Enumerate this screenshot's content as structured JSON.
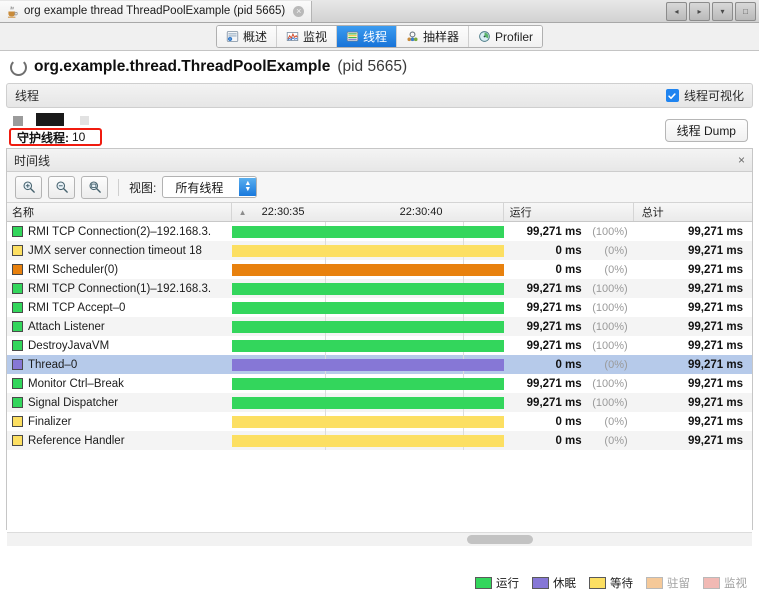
{
  "window": {
    "document_tab_title": "org example thread ThreadPoolExample (pid 5665)",
    "document_tab_close": "×",
    "nav_back": "◂",
    "nav_forward": "▸",
    "nav_dropdown": "▾",
    "maximize": "□"
  },
  "tabs": [
    {
      "label": "概述",
      "icon": "overview-icon",
      "selected": false
    },
    {
      "label": "监视",
      "icon": "monitor-icon",
      "selected": false
    },
    {
      "label": "线程",
      "icon": "threads-icon",
      "selected": true
    },
    {
      "label": "抽样器",
      "icon": "sampler-icon",
      "selected": false
    },
    {
      "label": "Profiler",
      "icon": "profiler-icon",
      "selected": false
    }
  ],
  "app_header": {
    "title": "org.example.thread.ThreadPoolExample",
    "pid": "(pid 5665)"
  },
  "section": {
    "title": "线程",
    "checkbox_label": "线程可视化",
    "checkbox_checked": true
  },
  "stats": {
    "daemon_label": "守护线程:",
    "daemon_value": "10",
    "highlight_color": "#f01b0f",
    "dump_button": "线程 Dump"
  },
  "timeline": {
    "panel_title": "时间线",
    "close": "×",
    "zoom_in": "zoom-in-icon",
    "zoom_out": "zoom-out-icon",
    "zoom_fit": "zoom-fit-icon",
    "view_label": "视图:",
    "view_value": "所有线程"
  },
  "grid": {
    "columns": {
      "name": "名称",
      "running": "运行",
      "total": "总计"
    },
    "time_ticks": [
      "22:30:35",
      "22:30:40"
    ],
    "rows": [
      {
        "name": "RMI TCP Connection(2)–192.168.3.",
        "color": "#33d65c",
        "running": "99,271 ms",
        "percent": "(100%)",
        "total": "99,271 ms",
        "selected": false
      },
      {
        "name": "JMX server connection timeout 18",
        "color": "#fcdf62",
        "running": "0 ms",
        "percent": "(0%)",
        "total": "99,271 ms",
        "selected": false
      },
      {
        "name": "RMI Scheduler(0)",
        "color": "#e8810e",
        "running": "0 ms",
        "percent": "(0%)",
        "total": "99,271 ms",
        "selected": false
      },
      {
        "name": "RMI TCP Connection(1)–192.168.3.",
        "color": "#33d65c",
        "running": "99,271 ms",
        "percent": "(100%)",
        "total": "99,271 ms",
        "selected": false
      },
      {
        "name": "RMI TCP Accept–0",
        "color": "#33d65c",
        "running": "99,271 ms",
        "percent": "(100%)",
        "total": "99,271 ms",
        "selected": false
      },
      {
        "name": "Attach Listener",
        "color": "#33d65c",
        "running": "99,271 ms",
        "percent": "(100%)",
        "total": "99,271 ms",
        "selected": false
      },
      {
        "name": "DestroyJavaVM",
        "color": "#33d65c",
        "running": "99,271 ms",
        "percent": "(100%)",
        "total": "99,271 ms",
        "selected": false
      },
      {
        "name": "Thread–0",
        "color": "#8677d6",
        "running": "0 ms",
        "percent": "(0%)",
        "total": "99,271 ms",
        "selected": true
      },
      {
        "name": "Monitor Ctrl–Break",
        "color": "#33d65c",
        "running": "99,271 ms",
        "percent": "(100%)",
        "total": "99,271 ms",
        "selected": false
      },
      {
        "name": "Signal Dispatcher",
        "color": "#33d65c",
        "running": "99,271 ms",
        "percent": "(100%)",
        "total": "99,271 ms",
        "selected": false
      },
      {
        "name": "Finalizer",
        "color": "#fcdf62",
        "running": "0 ms",
        "percent": "(0%)",
        "total": "99,271 ms",
        "selected": false
      },
      {
        "name": "Reference Handler",
        "color": "#fcdf62",
        "running": "0 ms",
        "percent": "(0%)",
        "total": "99,271 ms",
        "selected": false
      }
    ]
  },
  "legend": [
    {
      "label": "运行",
      "color": "#33d65c",
      "faded": false
    },
    {
      "label": "休眠",
      "color": "#8677d6",
      "faded": false
    },
    {
      "label": "等待",
      "color": "#fcdf62",
      "faded": false
    },
    {
      "label": "驻留",
      "color": "#e8810e",
      "faded": true
    },
    {
      "label": "监视",
      "color": "#e05a4e",
      "faded": true
    }
  ]
}
